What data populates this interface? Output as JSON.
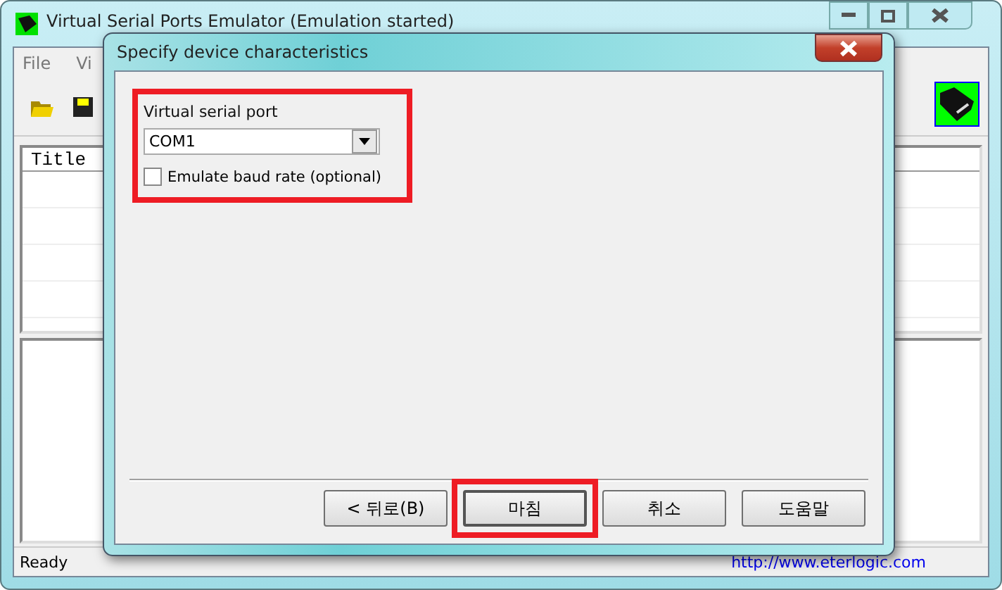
{
  "main_window": {
    "title": "Virtual Serial Ports Emulator (Emulation started)",
    "menu": [
      "File",
      "Vi"
    ],
    "table": {
      "columns": [
        "Title"
      ]
    },
    "status_bar": {
      "text": "Ready",
      "link": "http://www.eterlogic.com"
    }
  },
  "dialog": {
    "title": "Specify device characteristics",
    "group": {
      "highlighted": true,
      "port_label": "Virtual serial port",
      "port_value": "COM1",
      "baud_checkbox": {
        "label": "Emulate baud rate (optional)",
        "checked": false
      }
    },
    "buttons": [
      {
        "label": "< 뒤로(B)",
        "highlighted": false
      },
      {
        "label": "마침",
        "highlighted": true
      },
      {
        "label": "취소",
        "highlighted": false
      },
      {
        "label": "도움말",
        "highlighted": false
      }
    ]
  }
}
